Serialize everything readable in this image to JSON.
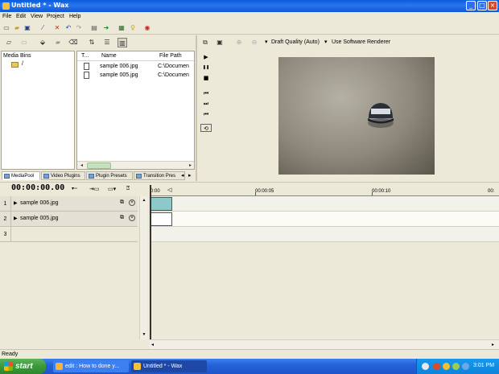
{
  "window": {
    "title": "Untitled * - Wax",
    "min": "_",
    "max": "□",
    "close": "×"
  },
  "menu": [
    "File",
    "Edit",
    "View",
    "Project",
    "Help"
  ],
  "toolbar_icons": [
    "new-file-icon",
    "open-folder-icon",
    "save-icon",
    "wand-icon",
    "delete-icon",
    "undo-icon",
    "redo-icon",
    "document-icon",
    "export-arrow-icon",
    "render-icon",
    "bulb-icon",
    "stop-icon"
  ],
  "media": {
    "bins_header": "Media Bins",
    "root_label": "/",
    "columns": {
      "type": "T...",
      "name": "Name",
      "path": "File Path"
    },
    "files": [
      {
        "name": "sample 006.jpg",
        "path": "C:\\Documen"
      },
      {
        "name": "sample 005.jpg",
        "path": "C:\\Documen"
      }
    ]
  },
  "tabs": [
    {
      "label": "MediaPool",
      "active": true
    },
    {
      "label": "Video Plugins",
      "active": false
    },
    {
      "label": "Plugin Presets",
      "active": false
    },
    {
      "label": "Transition Pres",
      "active": false
    }
  ],
  "tab_arrows": {
    "left": "◂",
    "right": "▸"
  },
  "preview": {
    "quality_label": "Draft Quality (Auto)",
    "renderer_label": "Use Software Renderer",
    "dropdown_glyph": "▾",
    "transport": {
      "play": "▶",
      "pause": "❚❚",
      "stop": "■",
      "prev": "⏮",
      "next": "⏭",
      "start": "⏮",
      "loop": "⟲"
    }
  },
  "timeline": {
    "timecode": "00:00:00.00",
    "ruler": [
      "0:00",
      "00:00:05",
      "00:00:10",
      "00:"
    ],
    "tracks": [
      {
        "num": "1",
        "name": "sample 006.jpg",
        "clip_color": "#8ec9c9"
      },
      {
        "num": "2",
        "name": "sample 005.jpg",
        "clip_color": "#ffffff"
      },
      {
        "num": "3",
        "name": ""
      }
    ],
    "track_glyphs": {
      "expand": "▶",
      "fx": "⧉",
      "remove": "×"
    },
    "hscroll": {
      "left": "◂",
      "right": "▸"
    },
    "vscroll": {
      "up": "▲",
      "down": "▼"
    }
  },
  "status": "Ready",
  "taskbar": {
    "start": "start",
    "items": [
      {
        "label": "edit : How to done y...",
        "active": false
      },
      {
        "label": "Untitled * - Wax",
        "active": true
      }
    ],
    "clock": "3:01 PM"
  },
  "colors": {
    "titlebar": "#0a5ce0",
    "taskbar": "#2462d8",
    "start": "#3a9a3a",
    "tray": "#0f83dc"
  }
}
